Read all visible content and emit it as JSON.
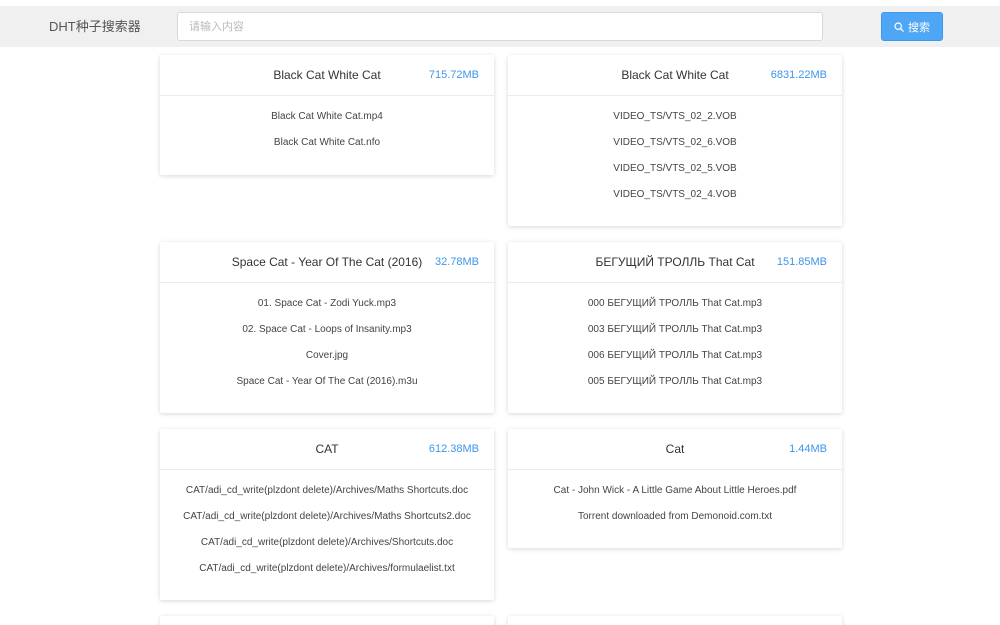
{
  "header": {
    "logo": "DHT种子搜索器",
    "search_placeholder": "请输入内容",
    "search_value": "",
    "search_button_label": "搜索"
  },
  "colors": {
    "accent": "#4ea6f5",
    "size_text": "#3d96e8",
    "header_bg": "#f0f0f0"
  },
  "results": [
    {
      "title": "Black Cat White Cat",
      "size": "715.72MB",
      "files": [
        "Black Cat White Cat.mp4",
        "Black Cat White Cat.nfo"
      ]
    },
    {
      "title": "Black Cat White Cat",
      "size": "6831.22MB",
      "files": [
        "VIDEO_TS/VTS_02_2.VOB",
        "VIDEO_TS/VTS_02_6.VOB",
        "VIDEO_TS/VTS_02_5.VOB",
        "VIDEO_TS/VTS_02_4.VOB"
      ]
    },
    {
      "title": "Space Cat - Year Of The Cat (2016)",
      "size": "32.78MB",
      "files": [
        "01. Space Cat - Zodi Yuck.mp3",
        "02. Space Cat - Loops of Insanity.mp3",
        "Cover.jpg",
        "Space Cat - Year Of The Cat (2016).m3u"
      ]
    },
    {
      "title": "БЕГУЩИЙ ТРОЛЛЬ That Cat",
      "size": "151.85MB",
      "files": [
        "000 БЕГУЩИЙ ТРОЛЛЬ That Cat.mp3",
        "003 БЕГУЩИЙ ТРОЛЛЬ That Cat.mp3",
        "006 БЕГУЩИЙ ТРОЛЛЬ That Cat.mp3",
        "005 БЕГУЩИЙ ТРОЛЛЬ That Cat.mp3"
      ]
    },
    {
      "title": "CAT",
      "size": "612.38MB",
      "files": [
        "CAT/adi_cd_write(plzdont delete)/Archives/Maths Shortcuts.doc",
        "CAT/adi_cd_write(plzdont delete)/Archives/Maths Shortcuts2.doc",
        "CAT/adi_cd_write(plzdont delete)/Archives/Shortcuts.doc",
        "CAT/adi_cd_write(plzdont delete)/Archives/formulaelist.txt"
      ]
    },
    {
      "title": "Cat",
      "size": "1.44MB",
      "files": [
        "Cat - John Wick - A Little Game About Little Heroes.pdf",
        "Torrent downloaded from Demonoid.com.txt"
      ]
    }
  ]
}
